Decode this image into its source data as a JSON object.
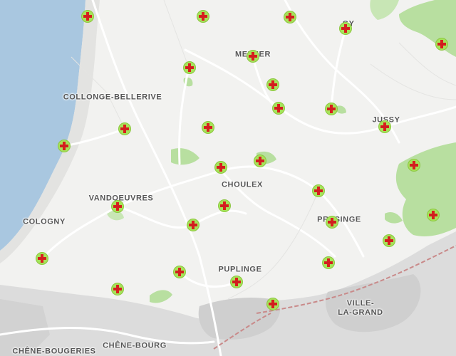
{
  "map": {
    "colors": {
      "water": "#a9c7e0",
      "land": "#f2f2f0",
      "park": "#b8dfa0",
      "urban": "#d6d6d6",
      "road": "#ffffff",
      "railway": "#c98a8a",
      "marker_fill": "#a6e35a",
      "marker_cross": "#d81e1e"
    },
    "marker_icon": "red-cross-icon",
    "places": [
      {
        "id": "meinier",
        "name": "MEINIER"
      },
      {
        "id": "gy",
        "name": "GY"
      },
      {
        "id": "collonge-bellerive",
        "name": "COLLONGE-BELLERIVE"
      },
      {
        "id": "jussy",
        "name": "JUSSY"
      },
      {
        "id": "choulex",
        "name": "CHOULEX"
      },
      {
        "id": "vandoeuvres",
        "name": "VANDOEUVRES"
      },
      {
        "id": "cologny",
        "name": "COLOGNY"
      },
      {
        "id": "presinge",
        "name": "PRESINGE"
      },
      {
        "id": "puplinge",
        "name": "PUPLINGE"
      },
      {
        "id": "ville-la-grand",
        "name": "VILLE-\nLA-GRAND"
      },
      {
        "id": "chene-bourg",
        "name": "CHÊNE-BOURG"
      },
      {
        "id": "chene-bougeries",
        "name": "CHÊNE-BOUGERIES"
      }
    ],
    "marker_count": 28
  }
}
